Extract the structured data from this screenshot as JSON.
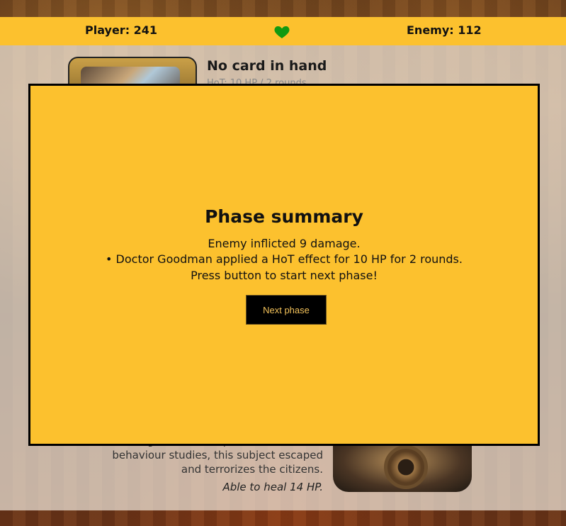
{
  "scoreboard": {
    "player": "Player: 241",
    "enemy": "Enemy: 112",
    "heart_icon": "heart-icon",
    "heart_color": "#119911"
  },
  "player_card": {
    "title": "No card in hand",
    "subtitle": "HoT: 10 HP / 2 rounds"
  },
  "enemy_card": {
    "description": "Starting out as an experiment for social behaviour studies, this subject escaped and terrorizes the citizens.",
    "ability": "Able to heal 14 HP."
  },
  "modal": {
    "title": "Phase summary",
    "lines": [
      "Enemy inflicted 9 damage.",
      "• Doctor Goodman applied a HoT effect for 10 HP for 2 rounds.",
      "Press button to start next phase!"
    ],
    "button_label": "Next phase",
    "background_color": "#fcc12e"
  }
}
